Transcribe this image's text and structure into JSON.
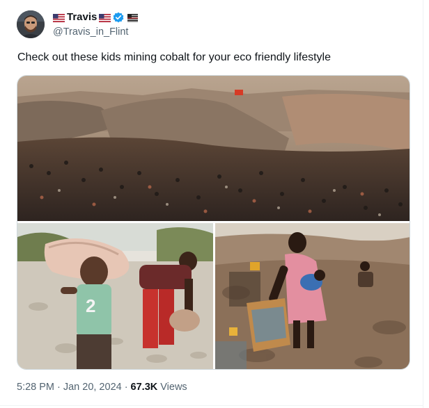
{
  "author": {
    "display_name": "Travis",
    "handle": "@Travis_in_Flint",
    "badges": [
      "us-flag-icon",
      "us-flag-icon",
      "verified-badge-icon",
      "flag-icon"
    ],
    "verified_color": "#1d9bf0"
  },
  "tweet": {
    "text": "Check out these kids mining cobalt for your eco friendly lifestyle"
  },
  "media": [
    {
      "name": "photo-mine-crowd",
      "description_icon": "photo-icon"
    },
    {
      "name": "photo-boy-carrying-sack",
      "description_icon": "photo-icon"
    },
    {
      "name": "photo-woman-with-baby",
      "description_icon": "photo-icon"
    }
  ],
  "meta": {
    "time": "5:28 PM",
    "separator": "·",
    "date": "Jan 20, 2024",
    "views_count": "67.3K",
    "views_label": "Views"
  },
  "colors": {
    "text_primary": "#0f1419",
    "text_secondary": "#536471",
    "border": "#cfd9de"
  }
}
